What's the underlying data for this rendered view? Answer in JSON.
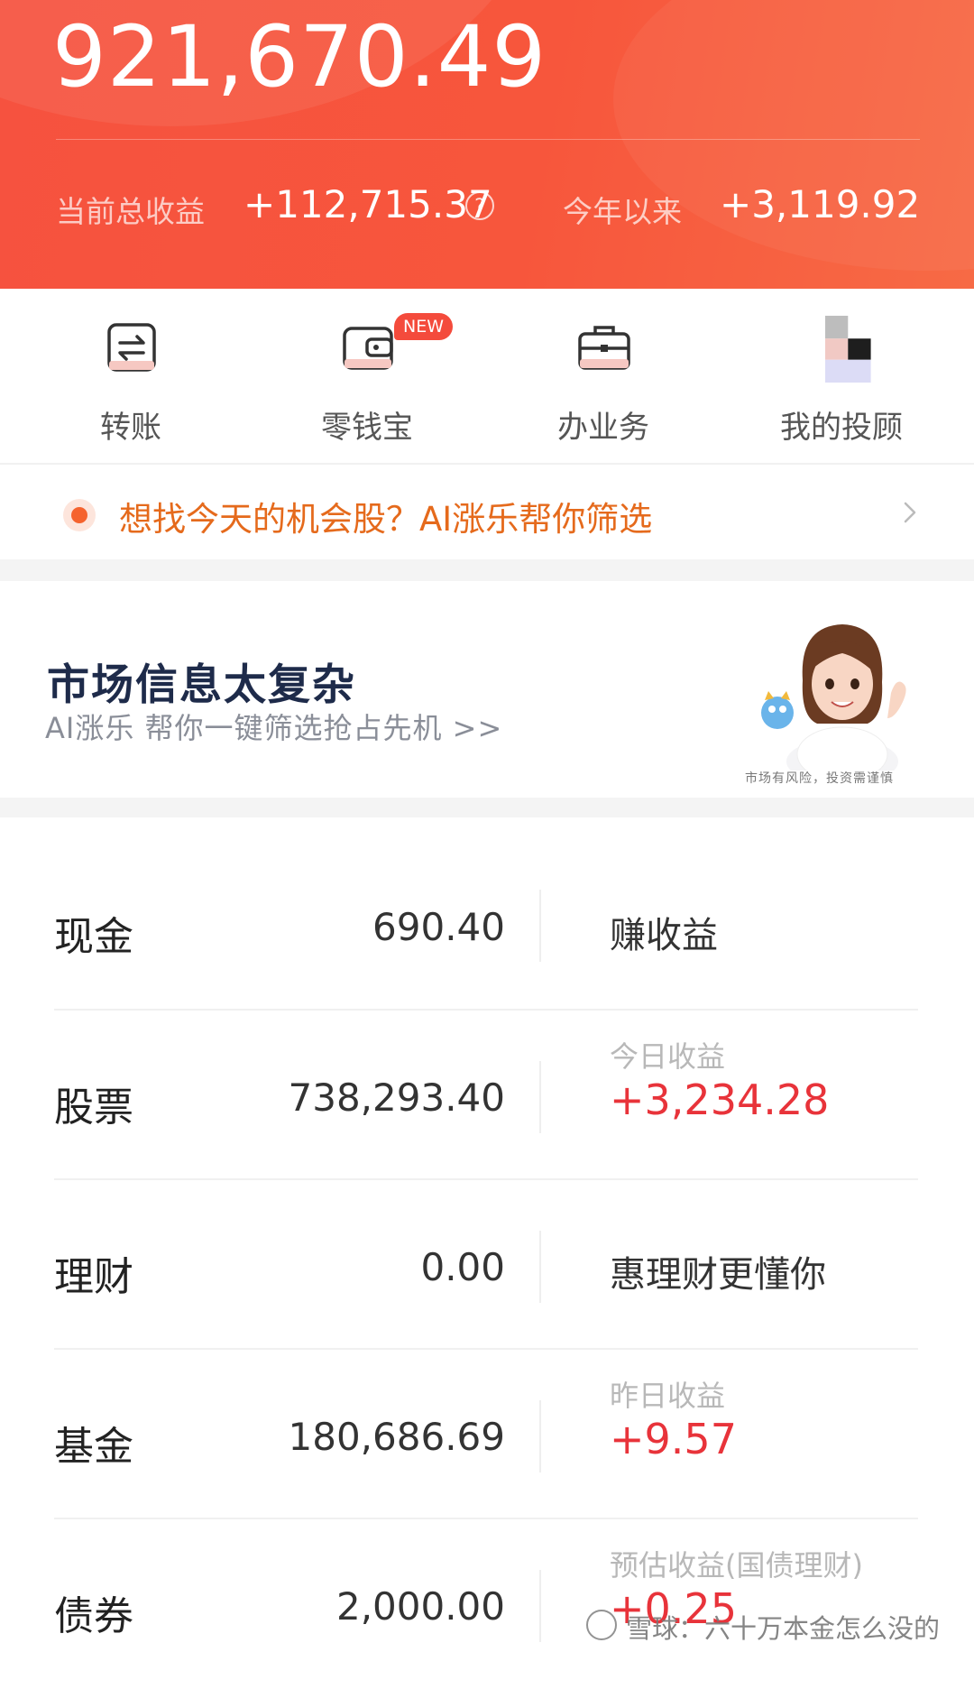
{
  "header": {
    "total_assets": "921,670.49",
    "total_profit_label": "当前总收益",
    "total_profit_value": "+112,715.37",
    "ytd_label": "今年以来",
    "ytd_value": "+3,119.92",
    "help_icon": "question-circle-icon"
  },
  "quick_actions": [
    {
      "label": "转账",
      "icon": "transfer-icon"
    },
    {
      "label": "零钱宝",
      "icon": "wallet-icon",
      "badge": "NEW"
    },
    {
      "label": "办业务",
      "icon": "briefcase-icon"
    },
    {
      "label": "我的投顾",
      "icon": "advisor-avatar-icon"
    }
  ],
  "ai_banner": {
    "text": "想找今天的机会股？AI涨乐帮你筛选",
    "icon": "chevron-right-icon"
  },
  "promo": {
    "title": "市场信息太复杂",
    "subtitle": "AI涨乐 帮你一键筛选抢占先机 >>",
    "risk_note": "市场有风险，投资需谨慎"
  },
  "assets": [
    {
      "name": "现金",
      "amount": "690.40",
      "right_text": "赚收益"
    },
    {
      "name": "股票",
      "amount": "738,293.40",
      "right_label": "今日收益",
      "right_value": "+3,234.28"
    },
    {
      "name": "理财",
      "amount": "0.00",
      "right_text": "惠理财更懂你"
    },
    {
      "name": "基金",
      "amount": "180,686.69",
      "right_label": "昨日收益",
      "right_value": "+9.57"
    },
    {
      "name": "债券",
      "amount": "2,000.00",
      "right_label": "预估收益(国债理财)",
      "right_value": "+0.25"
    }
  ],
  "watermark": "雪球：六十万本金怎么没的",
  "colors": {
    "header_red": "#f6523f",
    "gain_red": "#e8333a",
    "ai_orange": "#e56a1c"
  }
}
